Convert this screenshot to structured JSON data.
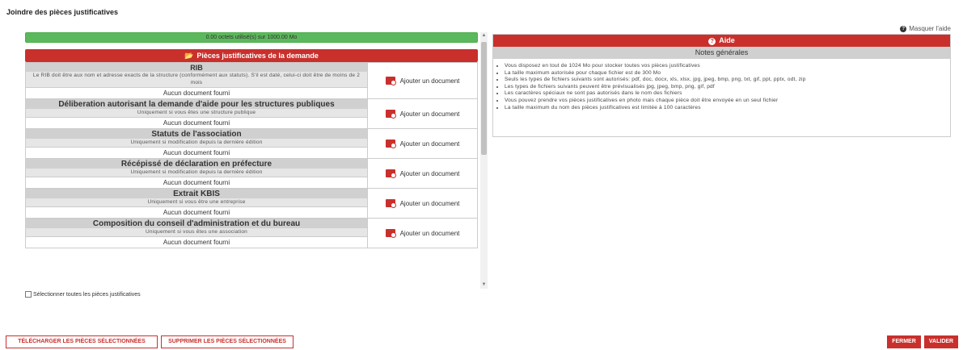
{
  "page": {
    "title": "Joindre des pièces justificatives"
  },
  "usage": {
    "label": "0.00 octets utilisé(s) sur 1000.00 Mo"
  },
  "section": {
    "title": "Pièces justificatives de la demande"
  },
  "documents": [
    {
      "name": "RIB",
      "desc": "Le RIB doit être aux nom et adresse exacts de la structure (conformément aux statuts). S'il est daté, celui-ci doit être de moins de 2 mois",
      "status": "Aucun document fourni",
      "action": "Ajouter un document"
    },
    {
      "name": "Déliberation autorisant la demande d'aide pour les structures publiques",
      "desc": "Uniquement si vous êtes une structure publique",
      "status": "Aucun document fourni",
      "action": "Ajouter un document"
    },
    {
      "name": "Statuts de l'association",
      "desc": "Uniquement si modification depuis la dernière édition",
      "status": "Aucun document fourni",
      "action": "Ajouter un document"
    },
    {
      "name": "Récépissé de déclaration en préfecture",
      "desc": "Uniquement si modification depuis la dernière édition",
      "status": "Aucun document fourni",
      "action": "Ajouter un document"
    },
    {
      "name": "Extrait KBIS",
      "desc": "Uniquement si vous être une entreprise",
      "status": "Aucun document fourni",
      "action": "Ajouter un document"
    },
    {
      "name": "Composition du conseil d'administration et du bureau",
      "desc": "Uniquement si vous êtes une association",
      "status": "Aucun document fourni",
      "action": "Ajouter un document"
    }
  ],
  "select_all": {
    "label": "Sélectionner toutes les pièces justificatives"
  },
  "help": {
    "hide_label": "Masquer l'aide",
    "title": "Aide",
    "notes_title": "Notes générales",
    "notes": [
      "Vous disposez en tout de 1024 Mo pour stocker toutes vos pièces justificatives",
      "La taille maximum autorisée pour chaque fichier est de 300 Mo",
      "Seuls les types de fichiers suivants sont autorisés: pdf, doc, docx, xls, xlsx, jpg, jpeg, bmp, png, txt, gif, ppt, pptx, odt, zip",
      "Les types de fichiers suivants peuvent être prévisualisés jpg, jpeg, bmp, png, gif, pdf",
      "Les caractères spéciaux ne sont pas autorisés dans le nom des fichiers",
      "Vous pouvez prendre vos pièces justificatives en photo mais chaque pièce doit être envoyée en un seul fichier",
      "La taille maximum du nom des pièces justificatives est limitée à 100 caractères"
    ]
  },
  "buttons": {
    "download": "TÉLÉCHARGER LES PIÈCES SÉLECTIONNÉES",
    "delete": "SUPPRIMER LES PIÈCES SÉLECTIONNÉES",
    "close": "FERMER",
    "validate": "VALIDER"
  },
  "colors": {
    "accent": "#c9302c",
    "progress": "#5cb85c",
    "header_grey": "#d0d0d0"
  }
}
